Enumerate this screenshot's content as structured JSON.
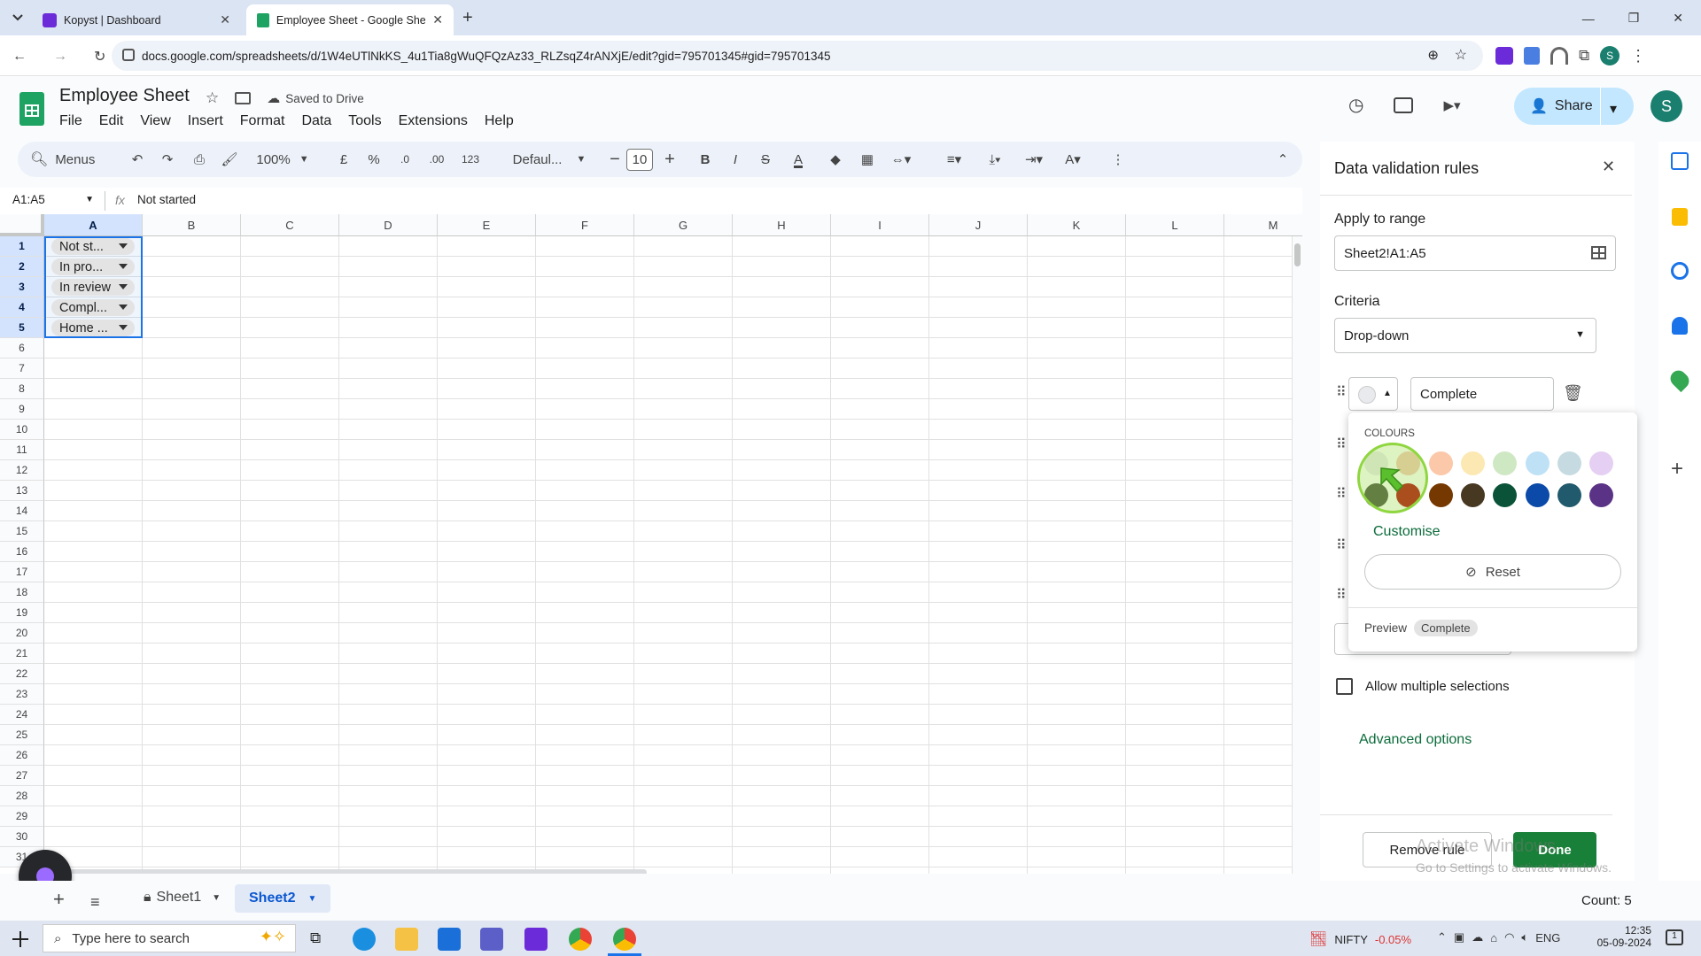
{
  "browser": {
    "tabs": [
      {
        "title": "Kopyst | Dashboard"
      },
      {
        "title": "Employee Sheet - Google Sheets"
      }
    ],
    "url": "docs.google.com/spreadsheets/d/1W4eUTlNkKS_4u1Tia8gWuQFQzAz33_RLZsqZ4rANXjE/edit?gid=795701345#gid=795701345",
    "profile_initial": "S"
  },
  "sheet": {
    "title": "Employee Sheet",
    "save_status": "Saved to Drive",
    "menu": [
      "File",
      "Edit",
      "View",
      "Insert",
      "Format",
      "Data",
      "Tools",
      "Extensions",
      "Help"
    ],
    "share_label": "Share",
    "user_initial": "S",
    "toolbar": {
      "menus_label": "Menus",
      "zoom": "100%",
      "currency": "£",
      "percent": "%",
      "dec_decrease": ".0",
      "dec_increase": ".00",
      "number_format": "123",
      "font": "Defaul...",
      "font_size": "10",
      "bold": "B",
      "italic": "I",
      "strike": "S",
      "text_color": "A"
    },
    "name_box": "A1:A5",
    "fx": "fx",
    "formula": "Not started",
    "columns": [
      "A",
      "B",
      "C",
      "D",
      "E",
      "F",
      "G",
      "H",
      "I",
      "J",
      "K",
      "L",
      "M"
    ],
    "rows": [
      "1",
      "2",
      "3",
      "4",
      "5",
      "6",
      "7",
      "8",
      "9",
      "10",
      "11",
      "12",
      "13",
      "14",
      "15",
      "16",
      "17",
      "18",
      "19",
      "20",
      "21",
      "22",
      "23",
      "24",
      "25",
      "26",
      "27",
      "28",
      "29",
      "30",
      "31"
    ],
    "cells_a": [
      "Not st...",
      "In pro...",
      "In review",
      "Compl...",
      "Home ..."
    ],
    "sheets": [
      {
        "name": "Sheet1"
      },
      {
        "name": "Sheet2"
      }
    ],
    "status": "Count: 5"
  },
  "panel": {
    "title": "Data validation rules",
    "apply_label": "Apply to range",
    "range_value": "Sheet2!A1:A5",
    "criteria_label": "Criteria",
    "criteria_value": "Drop-down",
    "item_value": "Complete",
    "colours_label": "COLOURS",
    "colours_row1": [
      "#e8eaed",
      "#f5c6b6",
      "#fbc8a9",
      "#fce8b2",
      "#cfe8c4",
      "#bfe1f6",
      "#c6dbe1",
      "#e5cff2"
    ],
    "colours_row2": [
      "#434e3a",
      "#b10202",
      "#753800",
      "#473822",
      "#0a5339",
      "#0b4aa8",
      "#215a6c",
      "#5a3286"
    ],
    "customise_label": "Customise",
    "reset_label": "Reset",
    "preview_label": "Preview",
    "preview_chip": "Complete",
    "allow_multiple": "Allow multiple selections",
    "advanced": "Advanced options",
    "remove_rule": "Remove rule",
    "done": "Done",
    "watermark1": "Activate Windows",
    "watermark2": "Go to Settings to activate Windows."
  },
  "taskbar": {
    "search_placeholder": "Type here to search",
    "nifty_label": "NIFTY",
    "nifty_change": "-0.05%",
    "lang": "ENG",
    "time": "12:35",
    "date": "05-09-2024",
    "notif_count": "1"
  }
}
